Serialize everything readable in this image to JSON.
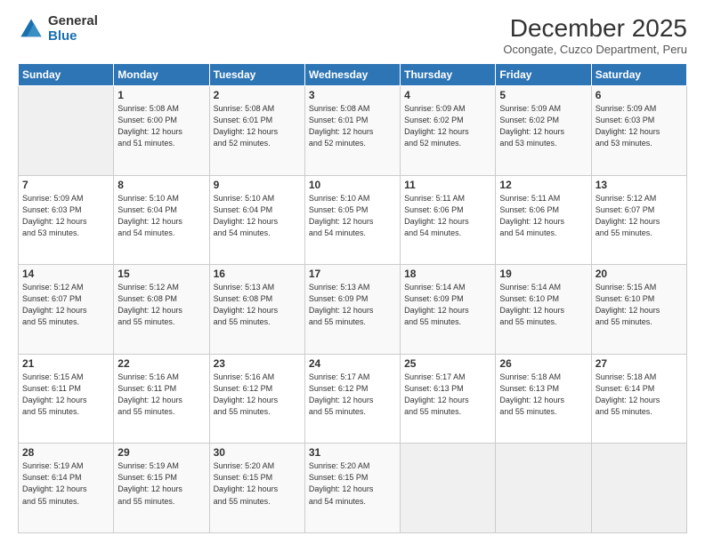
{
  "logo": {
    "general": "General",
    "blue": "Blue"
  },
  "header": {
    "month": "December 2025",
    "location": "Ocongate, Cuzco Department, Peru"
  },
  "weekdays": [
    "Sunday",
    "Monday",
    "Tuesday",
    "Wednesday",
    "Thursday",
    "Friday",
    "Saturday"
  ],
  "weeks": [
    [
      {
        "day": "",
        "info": ""
      },
      {
        "day": "1",
        "info": "Sunrise: 5:08 AM\nSunset: 6:00 PM\nDaylight: 12 hours\nand 51 minutes."
      },
      {
        "day": "2",
        "info": "Sunrise: 5:08 AM\nSunset: 6:01 PM\nDaylight: 12 hours\nand 52 minutes."
      },
      {
        "day": "3",
        "info": "Sunrise: 5:08 AM\nSunset: 6:01 PM\nDaylight: 12 hours\nand 52 minutes."
      },
      {
        "day": "4",
        "info": "Sunrise: 5:09 AM\nSunset: 6:02 PM\nDaylight: 12 hours\nand 52 minutes."
      },
      {
        "day": "5",
        "info": "Sunrise: 5:09 AM\nSunset: 6:02 PM\nDaylight: 12 hours\nand 53 minutes."
      },
      {
        "day": "6",
        "info": "Sunrise: 5:09 AM\nSunset: 6:03 PM\nDaylight: 12 hours\nand 53 minutes."
      }
    ],
    [
      {
        "day": "7",
        "info": "Sunrise: 5:09 AM\nSunset: 6:03 PM\nDaylight: 12 hours\nand 53 minutes."
      },
      {
        "day": "8",
        "info": "Sunrise: 5:10 AM\nSunset: 6:04 PM\nDaylight: 12 hours\nand 54 minutes."
      },
      {
        "day": "9",
        "info": "Sunrise: 5:10 AM\nSunset: 6:04 PM\nDaylight: 12 hours\nand 54 minutes."
      },
      {
        "day": "10",
        "info": "Sunrise: 5:10 AM\nSunset: 6:05 PM\nDaylight: 12 hours\nand 54 minutes."
      },
      {
        "day": "11",
        "info": "Sunrise: 5:11 AM\nSunset: 6:06 PM\nDaylight: 12 hours\nand 54 minutes."
      },
      {
        "day": "12",
        "info": "Sunrise: 5:11 AM\nSunset: 6:06 PM\nDaylight: 12 hours\nand 54 minutes."
      },
      {
        "day": "13",
        "info": "Sunrise: 5:12 AM\nSunset: 6:07 PM\nDaylight: 12 hours\nand 55 minutes."
      }
    ],
    [
      {
        "day": "14",
        "info": "Sunrise: 5:12 AM\nSunset: 6:07 PM\nDaylight: 12 hours\nand 55 minutes."
      },
      {
        "day": "15",
        "info": "Sunrise: 5:12 AM\nSunset: 6:08 PM\nDaylight: 12 hours\nand 55 minutes."
      },
      {
        "day": "16",
        "info": "Sunrise: 5:13 AM\nSunset: 6:08 PM\nDaylight: 12 hours\nand 55 minutes."
      },
      {
        "day": "17",
        "info": "Sunrise: 5:13 AM\nSunset: 6:09 PM\nDaylight: 12 hours\nand 55 minutes."
      },
      {
        "day": "18",
        "info": "Sunrise: 5:14 AM\nSunset: 6:09 PM\nDaylight: 12 hours\nand 55 minutes."
      },
      {
        "day": "19",
        "info": "Sunrise: 5:14 AM\nSunset: 6:10 PM\nDaylight: 12 hours\nand 55 minutes."
      },
      {
        "day": "20",
        "info": "Sunrise: 5:15 AM\nSunset: 6:10 PM\nDaylight: 12 hours\nand 55 minutes."
      }
    ],
    [
      {
        "day": "21",
        "info": "Sunrise: 5:15 AM\nSunset: 6:11 PM\nDaylight: 12 hours\nand 55 minutes."
      },
      {
        "day": "22",
        "info": "Sunrise: 5:16 AM\nSunset: 6:11 PM\nDaylight: 12 hours\nand 55 minutes."
      },
      {
        "day": "23",
        "info": "Sunrise: 5:16 AM\nSunset: 6:12 PM\nDaylight: 12 hours\nand 55 minutes."
      },
      {
        "day": "24",
        "info": "Sunrise: 5:17 AM\nSunset: 6:12 PM\nDaylight: 12 hours\nand 55 minutes."
      },
      {
        "day": "25",
        "info": "Sunrise: 5:17 AM\nSunset: 6:13 PM\nDaylight: 12 hours\nand 55 minutes."
      },
      {
        "day": "26",
        "info": "Sunrise: 5:18 AM\nSunset: 6:13 PM\nDaylight: 12 hours\nand 55 minutes."
      },
      {
        "day": "27",
        "info": "Sunrise: 5:18 AM\nSunset: 6:14 PM\nDaylight: 12 hours\nand 55 minutes."
      }
    ],
    [
      {
        "day": "28",
        "info": "Sunrise: 5:19 AM\nSunset: 6:14 PM\nDaylight: 12 hours\nand 55 minutes."
      },
      {
        "day": "29",
        "info": "Sunrise: 5:19 AM\nSunset: 6:15 PM\nDaylight: 12 hours\nand 55 minutes."
      },
      {
        "day": "30",
        "info": "Sunrise: 5:20 AM\nSunset: 6:15 PM\nDaylight: 12 hours\nand 55 minutes."
      },
      {
        "day": "31",
        "info": "Sunrise: 5:20 AM\nSunset: 6:15 PM\nDaylight: 12 hours\nand 54 minutes."
      },
      {
        "day": "",
        "info": ""
      },
      {
        "day": "",
        "info": ""
      },
      {
        "day": "",
        "info": ""
      }
    ]
  ]
}
